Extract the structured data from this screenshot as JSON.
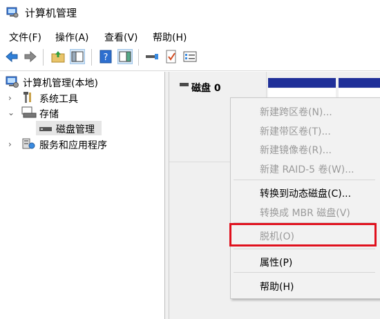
{
  "window": {
    "title": "计算机管理"
  },
  "menubar": {
    "items": [
      {
        "label": "文件(F)"
      },
      {
        "label": "操作(A)"
      },
      {
        "label": "查看(V)"
      },
      {
        "label": "帮助(H)"
      }
    ]
  },
  "toolbar": {
    "buttons": [
      "back-arrow-icon",
      "forward-arrow-icon",
      "up-folder-icon",
      "show-hide-tree-icon",
      "help-icon",
      "action-pane-icon",
      "connect-icon",
      "checklist-icon",
      "properties-icon"
    ]
  },
  "tree": {
    "root": "计算机管理(本地)",
    "items": [
      {
        "label": "系统工具"
      },
      {
        "label": "存储"
      },
      {
        "label": "磁盘管理"
      },
      {
        "label": "服务和应用程序"
      }
    ]
  },
  "disk": {
    "label": "磁盘 0"
  },
  "context_menu": {
    "items": [
      {
        "label": "新建跨区卷(N)...",
        "enabled": false
      },
      {
        "label": "新建带区卷(T)...",
        "enabled": false
      },
      {
        "label": "新建镜像卷(R)...",
        "enabled": false
      },
      {
        "label": "新建 RAID-5 卷(W)...",
        "enabled": false
      },
      {
        "label": "转换到动态磁盘(C)...",
        "enabled": true
      },
      {
        "label": "转换成 MBR 磁盘(V)",
        "enabled": false
      },
      {
        "label": "脱机(O)",
        "enabled": false
      },
      {
        "label": "属性(P)",
        "enabled": true
      },
      {
        "label": "帮助(H)",
        "enabled": true
      }
    ]
  },
  "colors": {
    "highlight": "#e0101d",
    "volume_header": "#1f2f98"
  }
}
